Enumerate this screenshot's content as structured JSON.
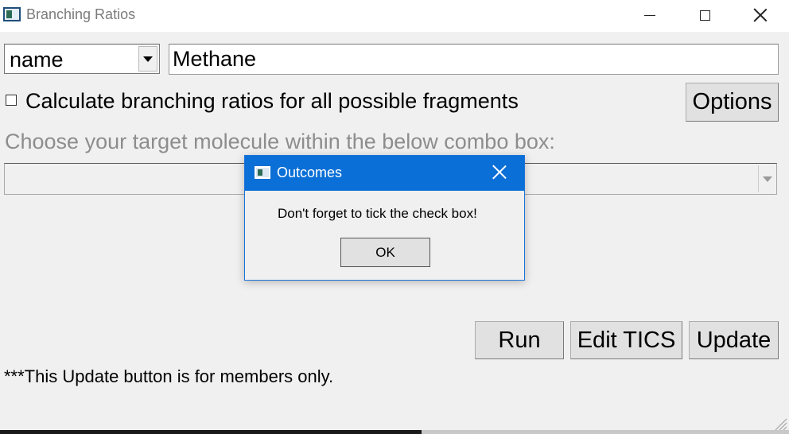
{
  "window": {
    "title": "Branching Ratios",
    "icon": "app-window-icon",
    "controls": [
      "minimize-icon",
      "maximize-icon",
      "close-icon"
    ]
  },
  "form": {
    "type_select_value": "name",
    "name_input_value": "Methane",
    "fragments_checkbox_checked": false,
    "fragments_checkbox_label": "Calculate branching ratios for all possible fragments",
    "options_label": "Options",
    "target_prompt": "Choose your target molecule within the below combo box:",
    "target_combo_value": ""
  },
  "actions": {
    "run_label": "Run",
    "edit_tics_label": "Edit TICS",
    "update_label": "Update"
  },
  "note": "***This Update button is for members only.",
  "dialog": {
    "title": "Outcomes",
    "message": "Don't forget to tick the check box!",
    "ok_label": "OK",
    "accent_color": "#0a6fd6"
  }
}
